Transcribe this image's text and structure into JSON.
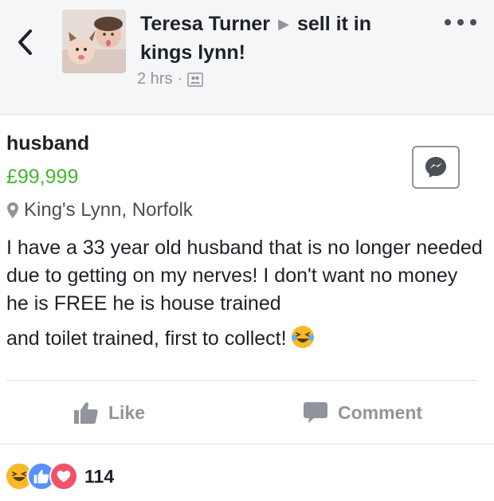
{
  "header": {
    "author": "Teresa Turner",
    "group": "sell it in kings lynn!",
    "time": "2 hrs",
    "separator": "·",
    "audience_icon": "group-icon",
    "more_icon": "more-dots-icon",
    "back_icon": "chevron-left-icon"
  },
  "listing": {
    "title": "husband",
    "price": "£99,999",
    "location": "King's Lynn, Norfolk",
    "description_main": "I have a 33 year old husband that is no longer needed due to getting on my nerves! I don't want no money he is FREE he is house trained",
    "description_last": "and toilet trained, first to collect!",
    "emoji": "laughing-tears-emoji",
    "message_icon": "messenger-icon"
  },
  "actions": {
    "like_label": "Like",
    "comment_label": "Comment"
  },
  "reactions": {
    "types": [
      "haha",
      "like",
      "love"
    ],
    "count": "114"
  },
  "colors": {
    "price": "#42b72a",
    "like_blue": "#5890ff",
    "love_red": "#f25268",
    "haha_yellow": "#f7b928",
    "meta_gray": "#90949c"
  }
}
